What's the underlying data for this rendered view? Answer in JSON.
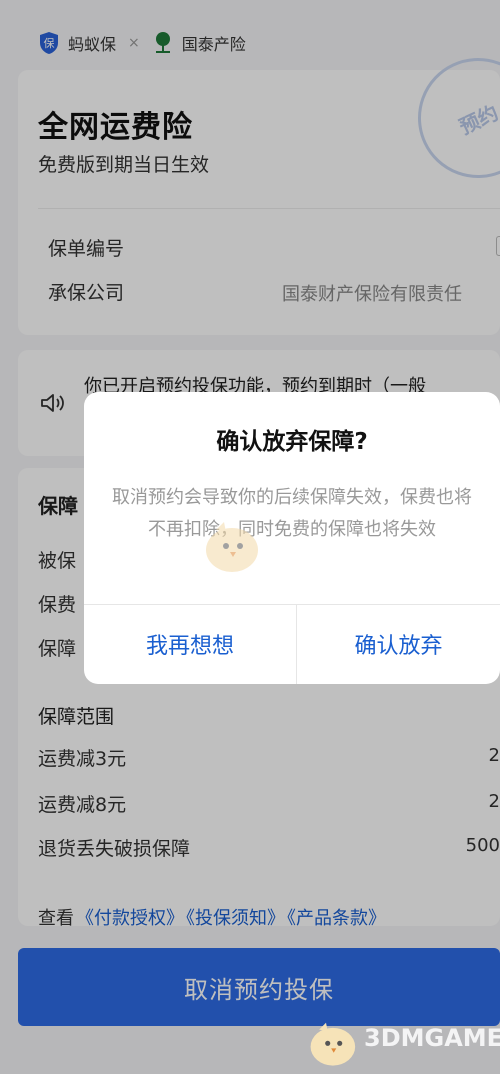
{
  "brand": {
    "name1": "蚂蚁保",
    "times": "×",
    "name2": "国泰产险"
  },
  "header": {
    "title": "全网运费险",
    "subtitle": "免费版到期当日生效",
    "stamp": "预约"
  },
  "policy": {
    "rows": [
      {
        "label": "保单编号",
        "value": ""
      },
      {
        "label": "承保公司",
        "value": "国泰财产保险有限责任"
      }
    ]
  },
  "notice": {
    "text": "你已开启预约投保功能，预约到期时（一般"
  },
  "coverage": {
    "section_title": "保障",
    "fields": [
      {
        "label": "被保"
      },
      {
        "label": "保费"
      },
      {
        "label": "保障"
      }
    ],
    "scope_title": "保障范围",
    "items": [
      {
        "label": "运费减3元",
        "value": "2"
      },
      {
        "label": "运费减8元",
        "value": "2"
      },
      {
        "label": "退货丢失破损保障",
        "value": "500"
      }
    ]
  },
  "links": {
    "prefix": "查看",
    "items": [
      "《付款授权》",
      "《投保须知》",
      "《产品条款》"
    ]
  },
  "bottom_button": "取消预约投保",
  "dialog": {
    "title": "确认放弃保障?",
    "message": "取消预约会导致你的后续保障失效，保费也将不再扣除，同时免费的保障也将失效",
    "cancel": "我再想想",
    "confirm": "确认放弃"
  },
  "watermark": {
    "text": "3DMGAME"
  },
  "colors": {
    "accent": "#1a5fd0",
    "button": "#2e6be6"
  }
}
